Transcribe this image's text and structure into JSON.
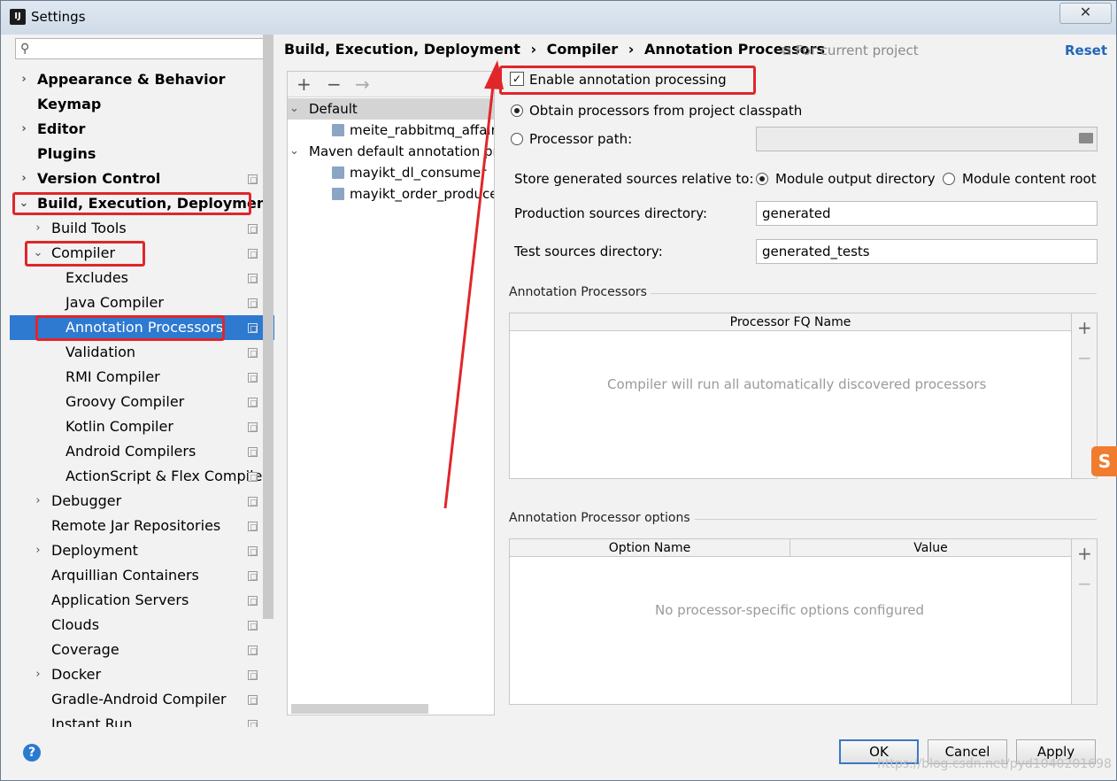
{
  "window": {
    "title": "Settings",
    "close_glyph": "✕"
  },
  "sidebar": {
    "search_placeholder": "",
    "items": [
      {
        "label": "Appearance & Behavior",
        "level": 0,
        "bold": true,
        "arrow": "›"
      },
      {
        "label": "Keymap",
        "level": 0,
        "bold": true,
        "arrow": ""
      },
      {
        "label": "Editor",
        "level": 0,
        "bold": true,
        "arrow": "›"
      },
      {
        "label": "Plugins",
        "level": 0,
        "bold": true,
        "arrow": ""
      },
      {
        "label": "Version Control",
        "level": 0,
        "bold": true,
        "arrow": "›"
      },
      {
        "label": "Build, Execution, Deployment",
        "level": 0,
        "bold": true,
        "arrow": "⌄"
      },
      {
        "label": "Build Tools",
        "level": 1,
        "bold": false,
        "arrow": "›"
      },
      {
        "label": "Compiler",
        "level": 1,
        "bold": false,
        "arrow": "⌄"
      },
      {
        "label": "Excludes",
        "level": 2,
        "bold": false,
        "arrow": ""
      },
      {
        "label": "Java Compiler",
        "level": 2,
        "bold": false,
        "arrow": ""
      },
      {
        "label": "Annotation Processors",
        "level": 2,
        "bold": false,
        "arrow": "",
        "selected": true
      },
      {
        "label": "Validation",
        "level": 2,
        "bold": false,
        "arrow": ""
      },
      {
        "label": "RMI Compiler",
        "level": 2,
        "bold": false,
        "arrow": ""
      },
      {
        "label": "Groovy Compiler",
        "level": 2,
        "bold": false,
        "arrow": ""
      },
      {
        "label": "Kotlin Compiler",
        "level": 2,
        "bold": false,
        "arrow": ""
      },
      {
        "label": "Android Compilers",
        "level": 2,
        "bold": false,
        "arrow": ""
      },
      {
        "label": "ActionScript & Flex Compile",
        "level": 2,
        "bold": false,
        "arrow": ""
      },
      {
        "label": "Debugger",
        "level": 1,
        "bold": false,
        "arrow": "›"
      },
      {
        "label": "Remote Jar Repositories",
        "level": 1,
        "bold": false,
        "arrow": ""
      },
      {
        "label": "Deployment",
        "level": 1,
        "bold": false,
        "arrow": "›"
      },
      {
        "label": "Arquillian Containers",
        "level": 1,
        "bold": false,
        "arrow": ""
      },
      {
        "label": "Application Servers",
        "level": 1,
        "bold": false,
        "arrow": ""
      },
      {
        "label": "Clouds",
        "level": 1,
        "bold": false,
        "arrow": ""
      },
      {
        "label": "Coverage",
        "level": 1,
        "bold": false,
        "arrow": ""
      },
      {
        "label": "Docker",
        "level": 1,
        "bold": false,
        "arrow": "›"
      },
      {
        "label": "Gradle-Android Compiler",
        "level": 1,
        "bold": false,
        "arrow": ""
      },
      {
        "label": "Instant Run",
        "level": 1,
        "bold": false,
        "arrow": ""
      }
    ]
  },
  "breadcrumb": {
    "part1": "Build, Execution, Deployment",
    "sep": "›",
    "part2": "Compiler",
    "part3": "Annotation Processors"
  },
  "project_note": "For current project",
  "reset_label": "Reset",
  "profiles": {
    "add": "+",
    "remove": "−",
    "move": "→",
    "rows": [
      {
        "label": "Default",
        "arrow": "⌄",
        "icon": false
      },
      {
        "label": "meite_rabbitmq_affair",
        "arrow": "",
        "icon": true
      },
      {
        "label": "Maven default annotation pr",
        "arrow": "⌄",
        "icon": false
      },
      {
        "label": "mayikt_dl_consumer",
        "arrow": "",
        "icon": true
      },
      {
        "label": "mayikt_order_producer",
        "arrow": "",
        "icon": true
      }
    ]
  },
  "options": {
    "enable_label": "Enable annotation processing",
    "enable_checked": "✓",
    "obtain_label": "Obtain processors from project classpath",
    "path_label": "Processor path:",
    "store_label": "Store generated sources relative to:",
    "module_output": "Module output directory",
    "module_content": "Module content root",
    "prod_label": "Production sources directory:",
    "prod_value": "generated",
    "test_label": "Test sources directory:",
    "test_value": "generated_tests"
  },
  "processors": {
    "section": "Annotation Processors",
    "column": "Processor FQ Name",
    "empty": "Compiler will run all automatically discovered processors",
    "add": "+",
    "remove": "−"
  },
  "processor_options": {
    "section": "Annotation Processor options",
    "col_name": "Option Name",
    "col_value": "Value",
    "empty": "No processor-specific options configured",
    "add": "+",
    "remove": "−"
  },
  "footer": {
    "help": "?",
    "ok": "OK",
    "cancel": "Cancel",
    "apply": "Apply",
    "watermark": "https://blog.csdn.net/pyd1040201698"
  },
  "sogou_glyph": "S",
  "colors": {
    "selection": "#2e7ad1",
    "annotation_red": "#e0262a",
    "link": "#2266b8"
  }
}
